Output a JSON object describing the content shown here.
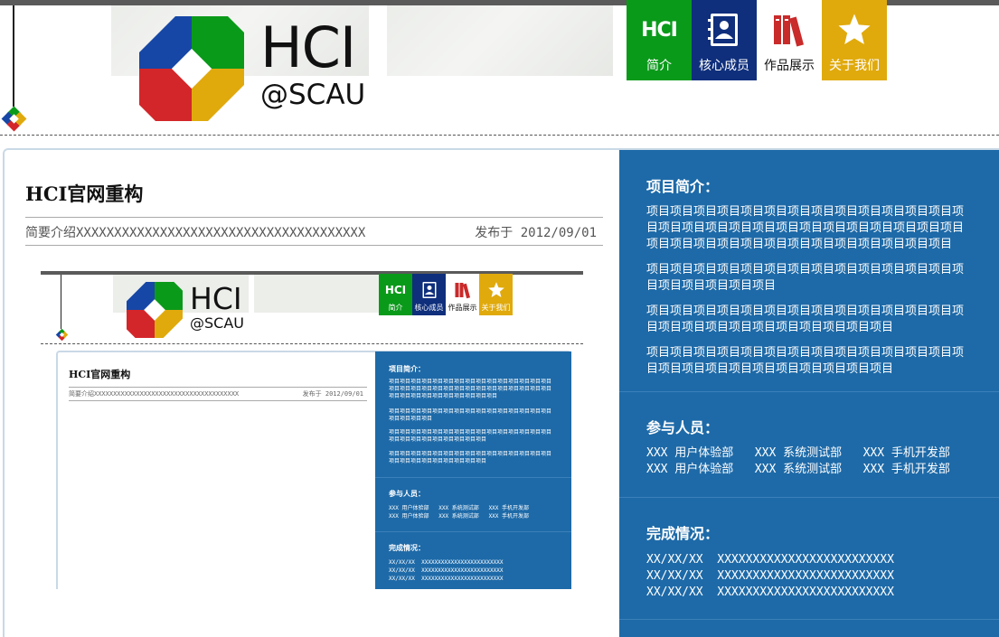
{
  "brand": {
    "name": "HCI",
    "sub": "@SCAU"
  },
  "nav": [
    {
      "label": "简介",
      "icon": "hci-badge-icon",
      "color": "#0a9a1a"
    },
    {
      "label": "核心成员",
      "icon": "contacts-book-icon",
      "color": "#0f2f7c"
    },
    {
      "label": "作品展示",
      "icon": "books-icon",
      "color": "#ffffff"
    },
    {
      "label": "关于我们",
      "icon": "star-icon",
      "color": "#e0aa0d"
    }
  ],
  "nav_icon_text": "HCI",
  "post": {
    "title": "HCI官网重构",
    "intro": "简要介绍XXXXXXXXXXXXXXXXXXXXXXXXXXXXXXXXXXXXXX",
    "date": "发布于 2012/09/01"
  },
  "sidebar": {
    "intro_heading": "项目简介：",
    "intro_paragraphs": [
      "项目项目项目项目项目项目项目项目项目项目项目项目项目项目项目项目项目项目项目项目项目项目项目项目项目项目项目项目项目项目项目项目项目项目项目项目项目项目项目项目",
      "项目项目项目项目项目项目项目项目项目项目项目项目项目项目项目项目项目项目项目",
      "项目项目项目项目项目项目项目项目项目项目项目项目项目项目项目项目项目项目项目项目项目项目项目项目",
      "项目项目项目项目项目项目项目项目项目项目项目项目项目项目项目项目项目项目项目项目项目项目项目项目"
    ],
    "members_heading": "参与人员：",
    "members": [
      "XXX 用户体验部   XXX 系统测试部   XXX 手机开发部",
      "XXX 用户体验部   XXX 系统测试部   XXX 手机开发部"
    ],
    "progress_heading": "完成情况：",
    "progress": [
      "XX/XX/XX  XXXXXXXXXXXXXXXXXXXXXXXXX",
      "XX/XX/XX  XXXXXXXXXXXXXXXXXXXXXXXXX",
      "XX/XX/XX  XXXXXXXXXXXXXXXXXXXXXXXXX"
    ]
  },
  "thumbnail": {
    "title": "HCI官网重构",
    "intro": "简要介绍XXXXXXXXXXXXXXXXXXXXXXXXXXXXXXXXXXXXXX",
    "date": "发布于 2012/09/01",
    "intro_heading": "项目简介：",
    "intro_paragraphs": [
      "项目项目项目项目项目项目项目项目项目项目项目项目项目项目项目项目项目项目项目项目项目项目项目项目项目项目项目项目项目项目项目项目项目项目项目项目项目项目项目项目",
      "项目项目项目项目项目项目项目项目项目项目项目项目项目项目项目项目项目项目项目",
      "项目项目项目项目项目项目项目项目项目项目项目项目项目项目项目项目项目项目项目项目项目项目项目项目",
      "项目项目项目项目项目项目项目项目项目项目项目项目项目项目项目项目项目项目项目项目项目项目项目项目"
    ],
    "members_heading": "参与人员：",
    "members": [
      "XXX 用户体验部   XXX 系统测试部   XXX 手机开发部",
      "XXX 用户体验部   XXX 系统测试部   XXX 手机开发部"
    ],
    "progress_heading": "完成情况：",
    "progress": [
      "XX/XX/XX  XXXXXXXXXXXXXXXXXXXXXXXXX",
      "XX/XX/XX  XXXXXXXXXXXXXXXXXXXXXXXXX",
      "XX/XX/XX  XXXXXXXXXXXXXXXXXXXXXXXXX"
    ]
  },
  "colors": {
    "blue_panel": "#1e6aa8",
    "logo_green": "#0a9a1a",
    "logo_blue": "#1747a6",
    "logo_red": "#d3262a",
    "logo_yellow": "#e0aa0d"
  }
}
